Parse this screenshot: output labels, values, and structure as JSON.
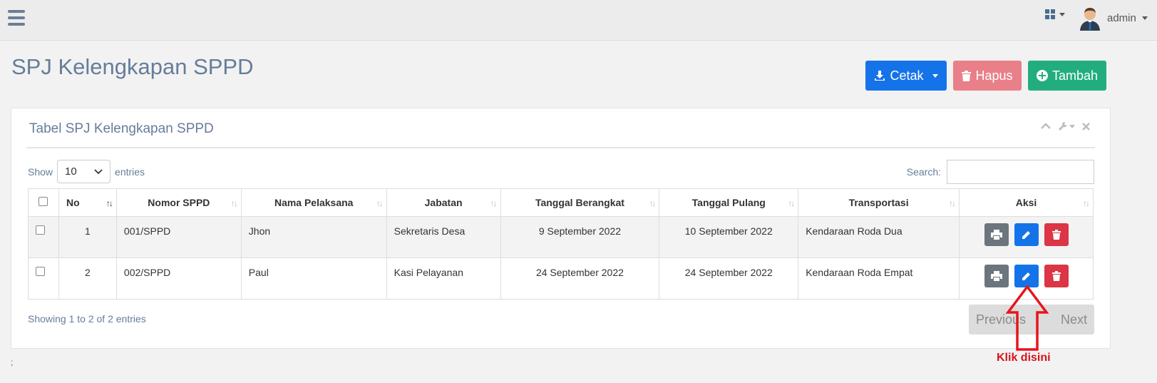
{
  "topbar": {
    "user_name": "admin"
  },
  "page": {
    "title": "SPJ Kelengkapan SPPD"
  },
  "toolbar": {
    "cetak_label": "Cetak",
    "hapus_label": "Hapus",
    "tambah_label": "Tambah"
  },
  "panel": {
    "title": "Tabel SPJ Kelengkapan SPPD",
    "show_label": "Show",
    "entries_value": "10",
    "entries_label": "entries",
    "search_label": "Search:",
    "search_value": ""
  },
  "table": {
    "headers": [
      "No",
      "Nomor SPPD",
      "Nama Pelaksana",
      "Jabatan",
      "Tanggal Berangkat",
      "Tanggal Pulang",
      "Transportasi",
      "Aksi"
    ],
    "rows": [
      {
        "no": "1",
        "nomor": "001/SPPD",
        "nama": "Jhon",
        "jabatan": "Sekretaris Desa",
        "berangkat": "9 September 2022",
        "pulang": "10 September 2022",
        "transportasi": "Kendaraan Roda Dua"
      },
      {
        "no": "2",
        "nomor": "002/SPPD",
        "nama": "Paul",
        "jabatan": "Kasi Pelayanan",
        "berangkat": "24 September 2022",
        "pulang": "24 September 2022",
        "transportasi": "Kendaraan Roda Empat"
      }
    ]
  },
  "footer": {
    "showing": "Showing 1 to 2 of 2 entries",
    "previous": "Previous",
    "next": "Next"
  },
  "annotation": {
    "text": "Klik disini",
    "color": "#d6141c"
  },
  "colors": {
    "primary": "#1573e9",
    "danger_light": "#e97f88",
    "success": "#22ad7f"
  },
  "stray_text": ";"
}
